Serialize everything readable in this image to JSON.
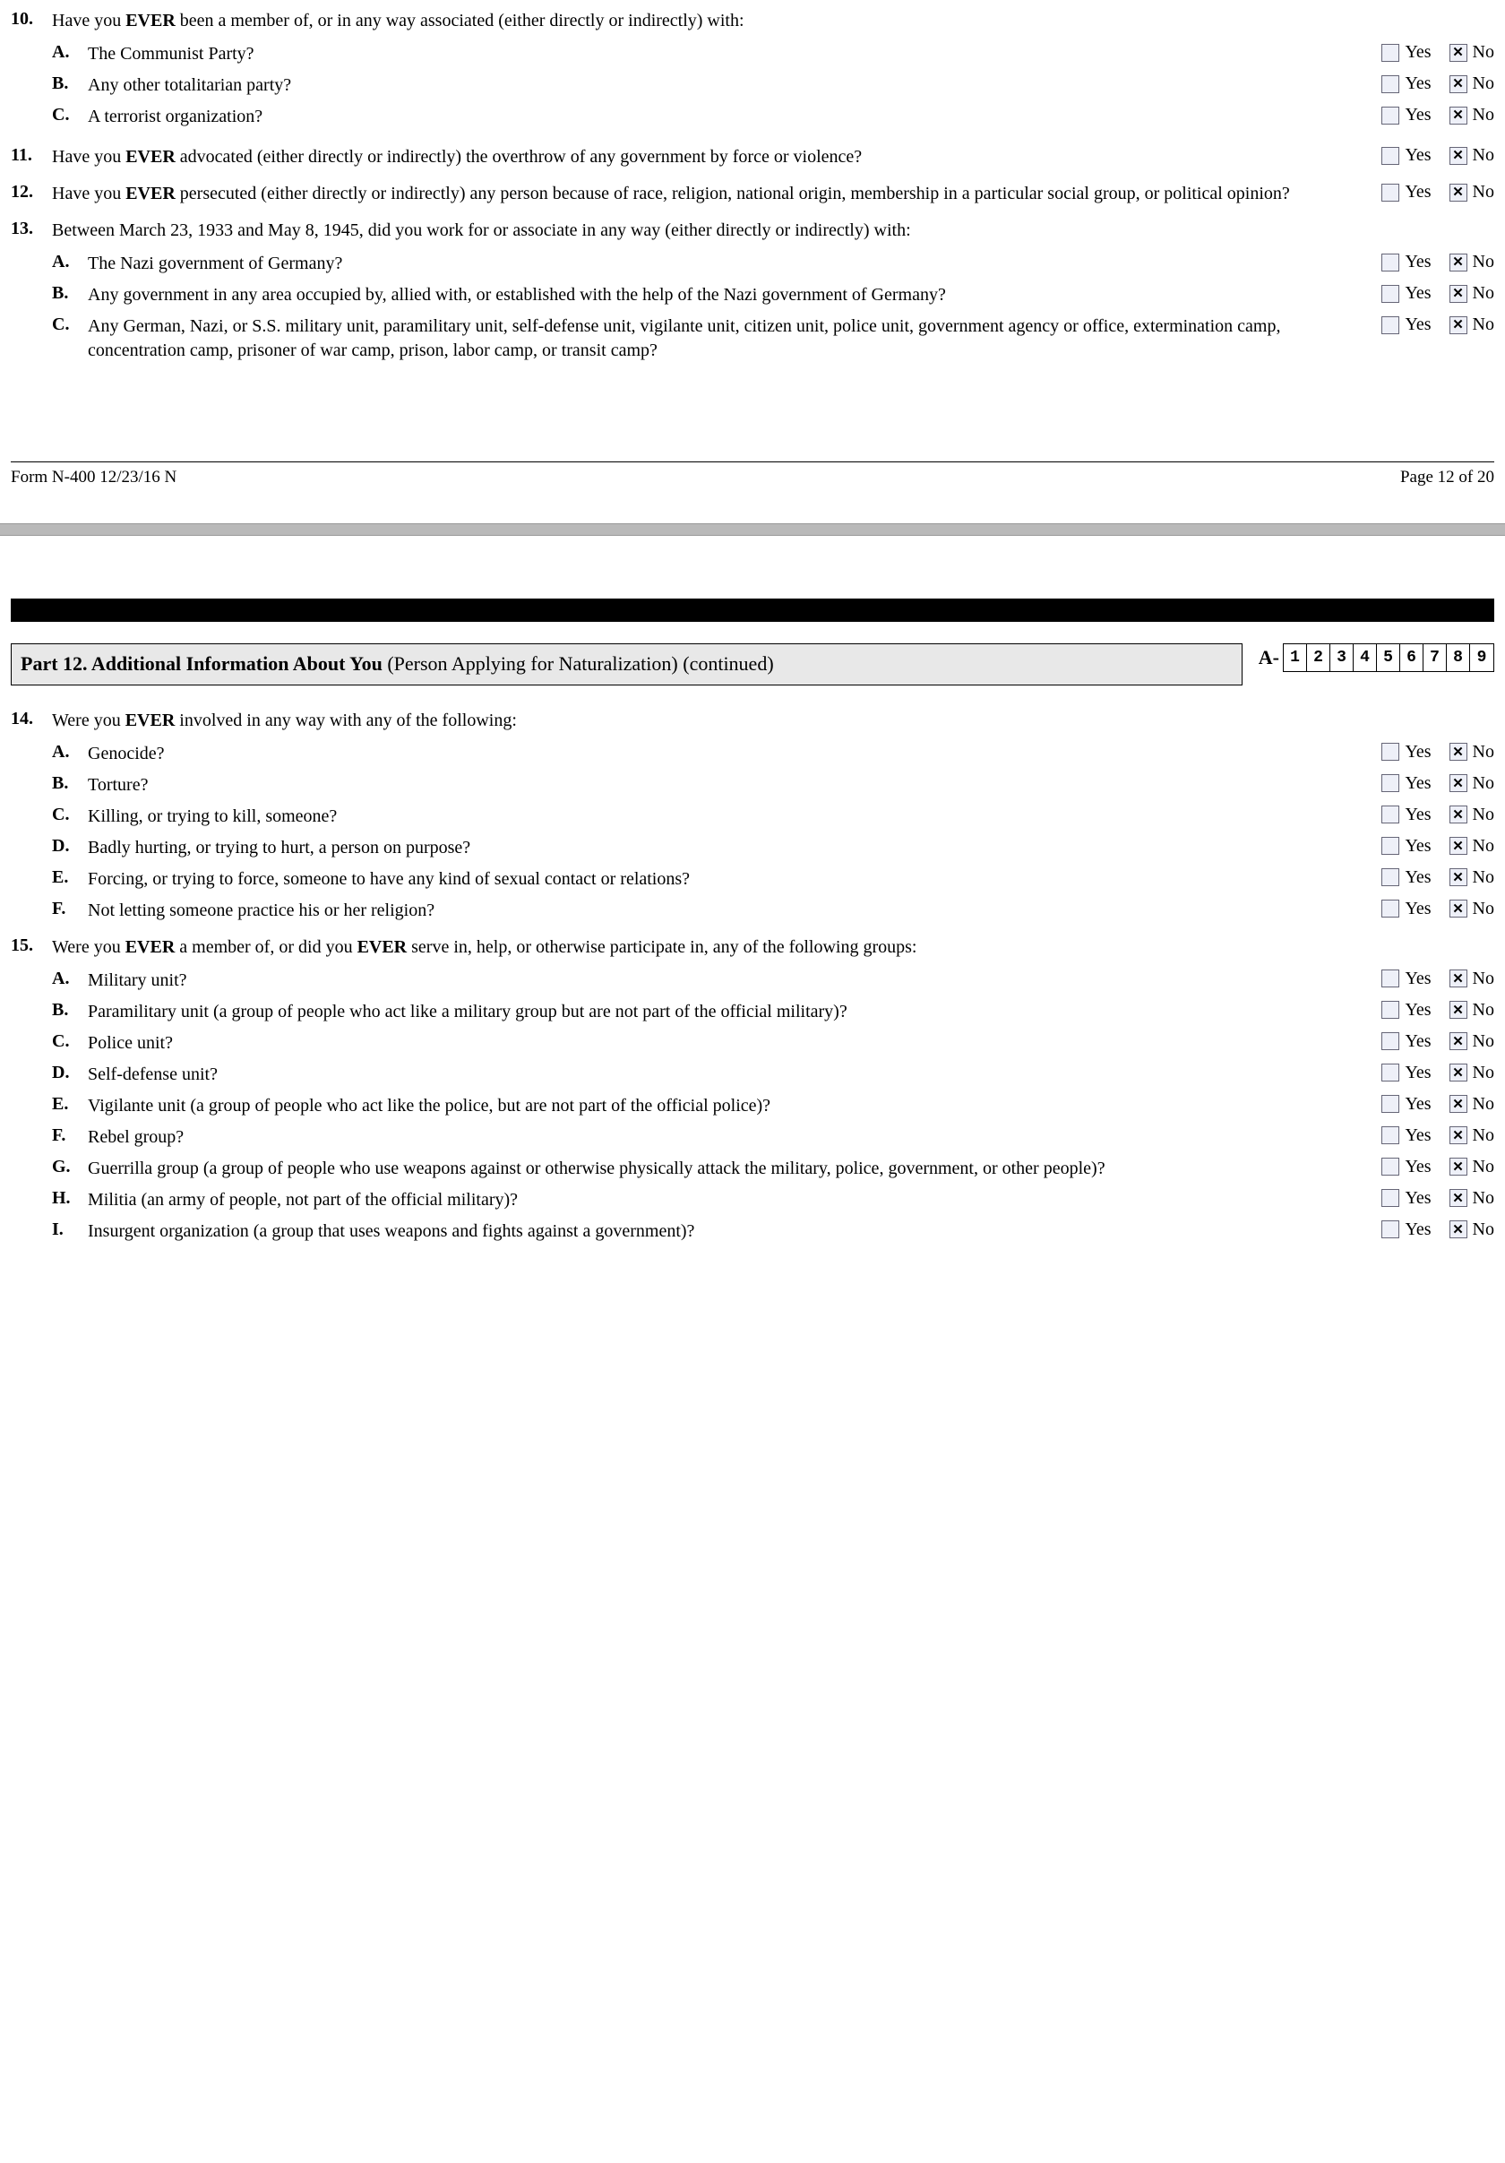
{
  "yesLabel": "Yes",
  "noLabel": "No",
  "q10": {
    "num": "10.",
    "text_pre": "Have you ",
    "ever": "EVER",
    "text_post": " been a member of, or in any way associated (either directly or indirectly) with:",
    "subs": {
      "A": {
        "letter": "A.",
        "text": "The Communist Party?",
        "yes": false,
        "no": true
      },
      "B": {
        "letter": "B.",
        "text": "Any other totalitarian party?",
        "yes": false,
        "no": true
      },
      "C": {
        "letter": "C.",
        "text": "A terrorist organization?",
        "yes": false,
        "no": true
      }
    }
  },
  "q11": {
    "num": "11.",
    "text_pre": "Have you ",
    "ever": "EVER",
    "text_post": " advocated (either directly or indirectly) the overthrow of any government by force or violence?",
    "yes": false,
    "no": true
  },
  "q12": {
    "num": "12.",
    "text_pre": "Have you ",
    "ever": "EVER",
    "text_post": " persecuted (either directly or indirectly) any person because of race, religion, national origin, membership in a particular social group, or political opinion?",
    "yes": false,
    "no": true
  },
  "q13": {
    "num": "13.",
    "text": "Between March 23, 1933 and May 8, 1945, did you work for or associate in any way (either directly or indirectly) with:",
    "subs": {
      "A": {
        "letter": "A.",
        "text": "The Nazi government of Germany?",
        "yes": false,
        "no": true
      },
      "B": {
        "letter": "B.",
        "text": "Any government in any area occupied by, allied with, or established with the help of the Nazi government of Germany?",
        "yes": false,
        "no": true
      },
      "C": {
        "letter": "C.",
        "text": "Any German, Nazi, or S.S. military unit, paramilitary unit, self-defense unit, vigilante unit, citizen unit, police unit, government agency or office, extermination camp, concentration camp, prisoner of war camp, prison, labor camp, or transit camp?",
        "yes": false,
        "no": true
      }
    }
  },
  "footer": {
    "form": "Form N-400   12/23/16   N",
    "page": "Page 12 of 20"
  },
  "part12": {
    "title_bold": "Part 12.  Additional Information About You ",
    "title_rest": "(Person Applying for Naturalization) (continued)",
    "a_prefix": "A-",
    "a_number": [
      "1",
      "2",
      "3",
      "4",
      "5",
      "6",
      "7",
      "8",
      "9"
    ]
  },
  "q14": {
    "num": "14.",
    "text_pre": "Were you ",
    "ever": "EVER",
    "text_post": " involved in any way with any of the following:",
    "subs": {
      "A": {
        "letter": "A.",
        "text": "Genocide?",
        "yes": false,
        "no": true
      },
      "B": {
        "letter": "B.",
        "text": "Torture?",
        "yes": false,
        "no": true
      },
      "C": {
        "letter": "C.",
        "text": "Killing, or trying to kill, someone?",
        "yes": false,
        "no": true
      },
      "D": {
        "letter": "D.",
        "text": "Badly hurting, or trying to hurt, a person on purpose?",
        "yes": false,
        "no": true
      },
      "E": {
        "letter": "E.",
        "text": "Forcing, or trying to force, someone to have any kind of sexual contact or relations?",
        "yes": false,
        "no": true
      },
      "F": {
        "letter": "F.",
        "text": "Not letting someone practice his or her religion?",
        "yes": false,
        "no": true
      }
    }
  },
  "q15": {
    "num": "15.",
    "text_pre": "Were you ",
    "ever1": "EVER",
    "text_mid": " a member of, or did you ",
    "ever2": "EVER",
    "text_post": " serve in, help, or otherwise participate in, any of the following groups:",
    "subs": {
      "A": {
        "letter": "A.",
        "text": "Military unit?",
        "yes": false,
        "no": true
      },
      "B": {
        "letter": "B.",
        "text": "Paramilitary unit (a group of people who act like a military group but are not part of the official military)?",
        "yes": false,
        "no": true
      },
      "C": {
        "letter": "C.",
        "text": "Police unit?",
        "yes": false,
        "no": true
      },
      "D": {
        "letter": "D.",
        "text": "Self-defense unit?",
        "yes": false,
        "no": true
      },
      "E": {
        "letter": "E.",
        "text": "Vigilante unit (a group of people who act like the police, but are not part of the official police)?",
        "yes": false,
        "no": true
      },
      "F": {
        "letter": "F.",
        "text": "Rebel group?",
        "yes": false,
        "no": true
      },
      "G": {
        "letter": "G.",
        "text": "Guerrilla group (a group of people who use weapons against or otherwise physically attack the military, police, government, or other people)?",
        "yes": false,
        "no": true
      },
      "H": {
        "letter": "H.",
        "text": "Militia (an army of people, not part of the official military)?",
        "yes": false,
        "no": true
      },
      "I": {
        "letter": "I.",
        "text": "Insurgent organization (a group that uses weapons and fights against a government)?",
        "yes": false,
        "no": true
      }
    }
  }
}
